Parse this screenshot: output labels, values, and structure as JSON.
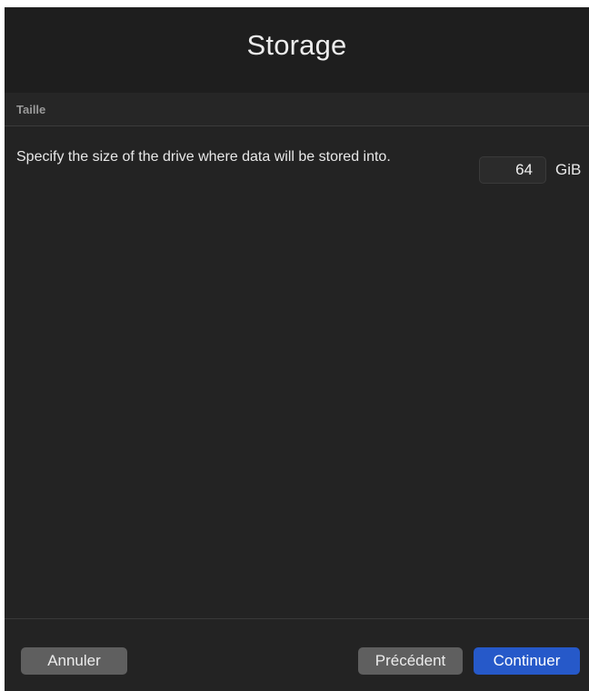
{
  "window": {
    "title": "Storage"
  },
  "section": {
    "label": "Taille"
  },
  "storage": {
    "description": "Specify the size of the drive where data will be stored into.",
    "size_value": "64",
    "unit": "GiB"
  },
  "footer": {
    "cancel_label": "Annuler",
    "back_label": "Précédent",
    "continue_label": "Continuer"
  },
  "colors": {
    "background": "#232323",
    "title_bar": "#1e1e1e",
    "primary_button": "#2659c9",
    "secondary_button": "#5f5f5f"
  }
}
